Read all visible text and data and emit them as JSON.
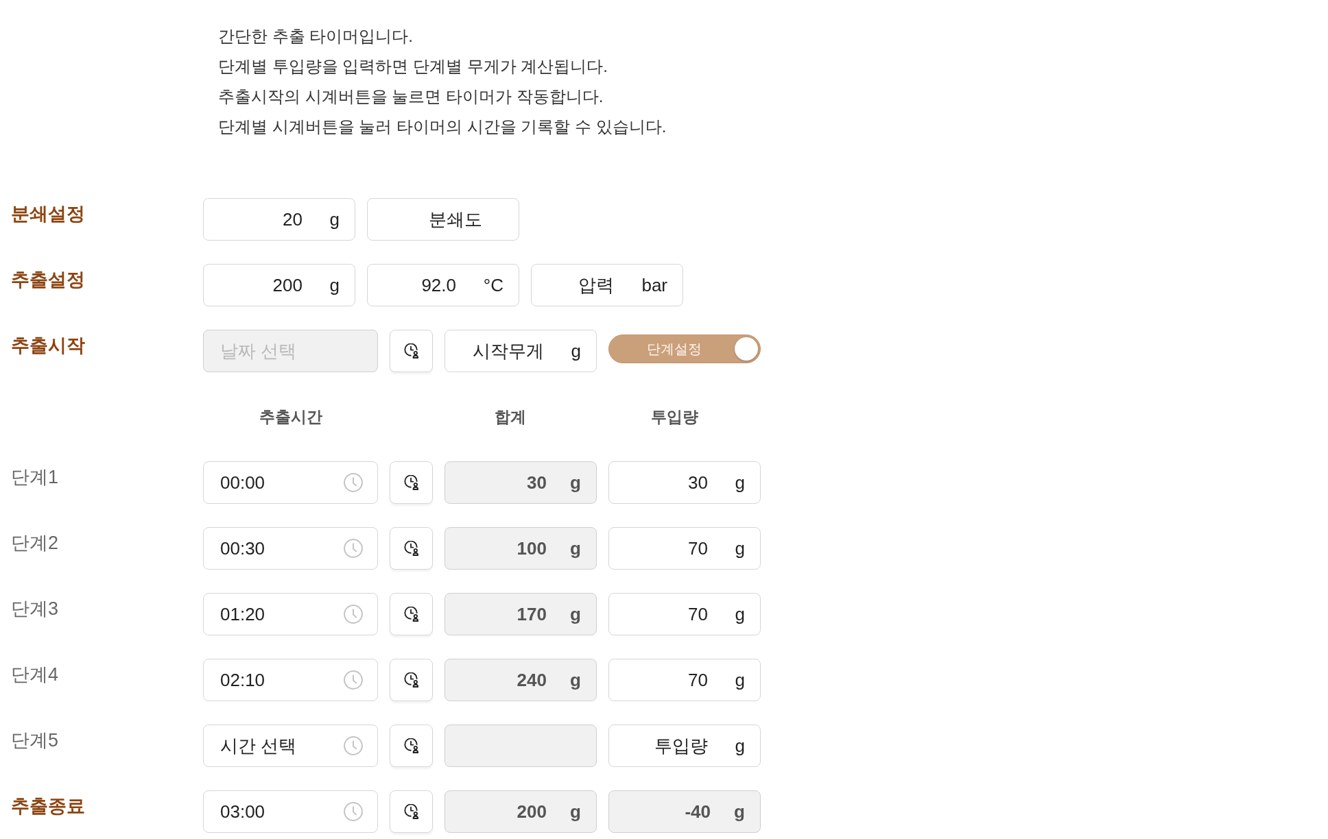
{
  "intro": [
    "간단한 추출 타이머입니다.",
    "단계별 투입량을 입력하면 단계별 무게가 계산됩니다.",
    "추출시작의 시계버튼을 눌르면 타이머가 작동합니다.",
    "단계별 시계버튼을 눌러 타이머의 시간을 기록할 수 있습니다."
  ],
  "grind": {
    "label": "분쇄설정",
    "fields": [
      {
        "value": "20",
        "unit": "g"
      },
      {
        "placeholder": "분쇄도"
      }
    ]
  },
  "brew": {
    "label": "추출설정",
    "fields": [
      {
        "value": "200",
        "unit": "g"
      },
      {
        "value": "92.0",
        "unit": "°C"
      },
      {
        "placeholder": "압력",
        "unit": "bar"
      }
    ]
  },
  "start": {
    "label": "추출시작",
    "date": {
      "placeholder": "날짜 선택",
      "disabled": true
    },
    "start_weight": {
      "placeholder": "시작무게",
      "unit": "g"
    },
    "step_toggle": {
      "label": "단계설정",
      "on": true
    }
  },
  "columns": [
    "추출시간",
    "합계",
    "투입량"
  ],
  "steps": [
    {
      "kind": "step",
      "label": "단계1",
      "time": {
        "value": "00:00"
      },
      "total": {
        "value": "30",
        "unit": "g",
        "disabled": true
      },
      "amount": {
        "value": "30",
        "unit": "g",
        "disabled": false
      }
    },
    {
      "kind": "step",
      "label": "단계2",
      "time": {
        "value": "00:30"
      },
      "total": {
        "value": "100",
        "unit": "g",
        "disabled": true
      },
      "amount": {
        "value": "70",
        "unit": "g",
        "disabled": false
      }
    },
    {
      "kind": "step",
      "label": "단계3",
      "time": {
        "value": "01:20"
      },
      "total": {
        "value": "170",
        "unit": "g",
        "disabled": true
      },
      "amount": {
        "value": "70",
        "unit": "g",
        "disabled": false
      }
    },
    {
      "kind": "step",
      "label": "단계4",
      "time": {
        "value": "02:10"
      },
      "total": {
        "value": "240",
        "unit": "g",
        "disabled": true
      },
      "amount": {
        "value": "70",
        "unit": "g",
        "disabled": false
      }
    },
    {
      "kind": "step",
      "label": "단계5",
      "time": {
        "placeholder": "시간 선택"
      },
      "total": {
        "disabled": true
      },
      "amount": {
        "placeholder": "투입량",
        "unit": "g",
        "disabled": false
      }
    },
    {
      "kind": "end",
      "label": "추출종료",
      "time": {
        "value": "03:00"
      },
      "total": {
        "value": "200",
        "unit": "g",
        "disabled": true
      },
      "amount": {
        "value": "-40",
        "unit": "g",
        "disabled": true
      }
    }
  ]
}
